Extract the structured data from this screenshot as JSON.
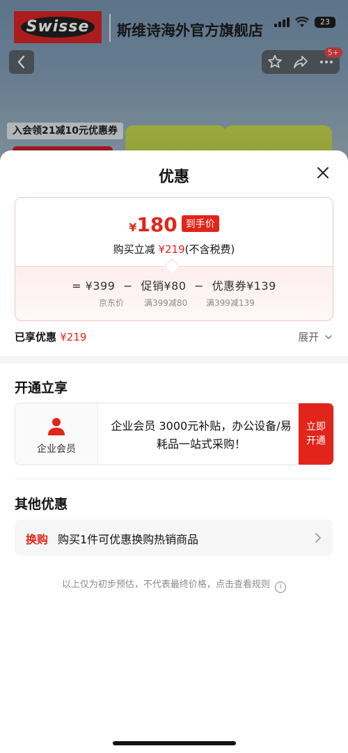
{
  "background": {
    "brand_logo_text": "Swisse",
    "store_name": "斯维诗海外官方旗舰店",
    "battery_level": "23",
    "notification_badge": "5+",
    "promo_strip": "入会领21减10元优惠券"
  },
  "sheet": {
    "title": "优惠",
    "price": {
      "currency": "¥",
      "final_price": "180",
      "final_tag": "到手价",
      "instant_label": "购买立减",
      "instant_amount": "¥219",
      "instant_note": "(不含税费)"
    },
    "breakdown": {
      "equals": "=",
      "jd_price": "¥399",
      "minus": "−",
      "promo_label": "促销¥80",
      "coupon_label": "优惠券¥139",
      "jd_price_caption": "京东价",
      "promo_caption": "满399减80",
      "coupon_caption": "满399减139"
    },
    "enjoyed_label": "已享优惠",
    "enjoyed_amount": "¥219",
    "expand_label": "展开",
    "open_section_title": "开通立享",
    "member": {
      "label": "企业会员",
      "description": "企业会员 3000元补贴，办公设备/易耗品一站式采购！",
      "button_line1": "立即",
      "button_line2": "开通"
    },
    "other_section_title": "其他优惠",
    "swap": {
      "tag": "换购",
      "text": "购买1件可优惠换购热销商品"
    },
    "footnote": "以上仅为初步预估，不代表最终价格，点击查看规则"
  },
  "colors": {
    "accent_red": "#e1251b",
    "brand_red": "#d7181b"
  },
  "icons": [
    "back-icon",
    "star-icon",
    "share-icon",
    "more-icon",
    "close-icon",
    "user-icon",
    "chevron-right-icon",
    "chevron-down-icon",
    "info-icon",
    "wifi-icon",
    "signal-icon"
  ]
}
